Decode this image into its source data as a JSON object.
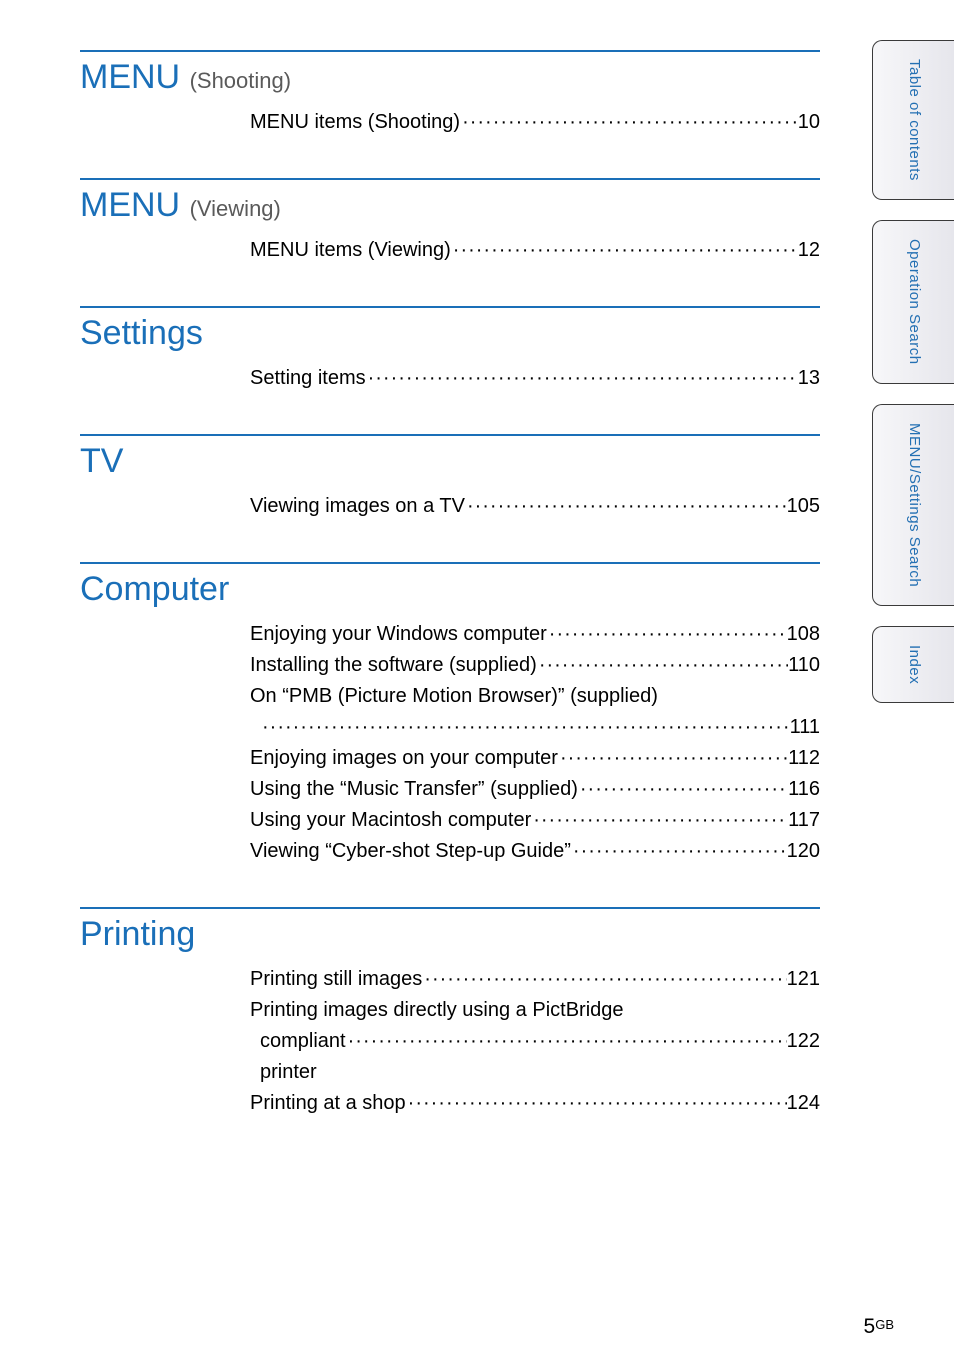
{
  "sections": [
    {
      "title": "MENU",
      "mode": "(Shooting)",
      "entries": [
        {
          "label": "MENU items (Shooting)",
          "page": "10"
        }
      ]
    },
    {
      "title": "MENU",
      "mode": "(Viewing)",
      "entries": [
        {
          "label": "MENU items (Viewing)",
          "page": "12"
        }
      ]
    },
    {
      "title": "Settings",
      "mode": "",
      "entries": [
        {
          "label": "Setting items",
          "page": "13"
        }
      ]
    },
    {
      "title": "TV",
      "mode": "",
      "entries": [
        {
          "label": "Viewing images on a TV",
          "page": "105"
        }
      ]
    },
    {
      "title": "Computer",
      "mode": "",
      "entries": [
        {
          "label": "Enjoying your Windows computer",
          "page": "108"
        },
        {
          "label": "Installing the software (supplied)",
          "page": "110"
        },
        {
          "label": "On “PMB (Picture Motion Browser)” (supplied)",
          "page": "111",
          "wrap": true
        },
        {
          "label": "Enjoying images on your computer",
          "page": "112"
        },
        {
          "label": "Using the “Music Transfer” (supplied)",
          "page": "116"
        },
        {
          "label": "Using your Macintosh computer",
          "page": "117"
        },
        {
          "label": "Viewing “Cyber-shot Step-up Guide”",
          "page": "120"
        }
      ]
    },
    {
      "title": "Printing",
      "mode": "",
      "entries": [
        {
          "label": "Printing still images",
          "page": "121"
        },
        {
          "label": "Printing images directly using a PictBridge compliant printer",
          "page": "122",
          "wrap": true,
          "wrap_first": "Printing images directly using a PictBridge",
          "wrap_second": "compliant printer"
        },
        {
          "label": "Printing at a shop",
          "page": "124"
        }
      ]
    }
  ],
  "tabs": [
    {
      "label": "Table of\ncontents"
    },
    {
      "label": "Operation\nSearch"
    },
    {
      "label": "MENU/Settings\nSearch"
    },
    {
      "label": "Index"
    }
  ],
  "footer": {
    "page": "5",
    "gb": "GB"
  }
}
